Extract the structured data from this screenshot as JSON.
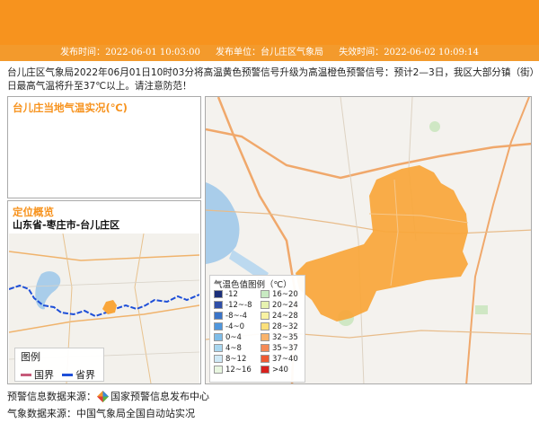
{
  "header": {
    "issue_time_label": "发布时间：",
    "issue_time": "2022-06-01 10:03:00",
    "publisher_label": "发布单位：",
    "publisher": "台儿庄区气象局",
    "expire_label": "失效时间：",
    "expire_time": "2022-06-02 10:09:14"
  },
  "description": "台儿庄区气象局2022年06月01日10时03分将高温黄色预警信号升级为高温橙色预警信号：预计2—3日，我区大部分镇（街）日最高气温将升至37℃以上。请注意防范！",
  "temp_panel": {
    "title": "台儿庄当地气温实况(℃)"
  },
  "location_panel": {
    "title": "定位概览",
    "region": "山东省-枣庄市-台儿庄区",
    "legend_title": "图例",
    "legend_items": [
      {
        "label": "国界",
        "color": "#c75b7a"
      },
      {
        "label": "省界",
        "color": "#1e4fd8"
      }
    ]
  },
  "map_legend": {
    "title": "气温色值图例（℃）",
    "items": [
      {
        "label": "-12",
        "color": "#1b2f7a"
      },
      {
        "label": "-12~-8",
        "color": "#2f4fa8"
      },
      {
        "label": "-8~-4",
        "color": "#3a74c8"
      },
      {
        "label": "-4~0",
        "color": "#4f96dd"
      },
      {
        "label": "0~4",
        "color": "#7fbde8"
      },
      {
        "label": "4~8",
        "color": "#a9d7f0"
      },
      {
        "label": "8~12",
        "color": "#cfe9f6"
      },
      {
        "label": "12~16",
        "color": "#e8f6e0"
      },
      {
        "label": "16~20",
        "color": "#c8eac2"
      },
      {
        "label": "20~24",
        "color": "#e7f3b0"
      },
      {
        "label": "24~28",
        "color": "#f8f2a2"
      },
      {
        "label": "28~32",
        "color": "#fbe07b"
      },
      {
        "label": "32~35",
        "color": "#f9b36b"
      },
      {
        "label": "35~37",
        "color": "#f58a56"
      },
      {
        "label": "37~40",
        "color": "#ee5a33"
      },
      {
        "label": ">40",
        "color": "#d8211e"
      }
    ]
  },
  "footer": {
    "warning_source_label": "预警信息数据来源：",
    "warning_source": "国家预警信息发布中心",
    "weather_source_label": "气象数据来源：",
    "weather_source": "中国气象局全国自动站实况"
  },
  "colors": {
    "accent": "#f7931e",
    "warning_area": "#f9a63a"
  }
}
